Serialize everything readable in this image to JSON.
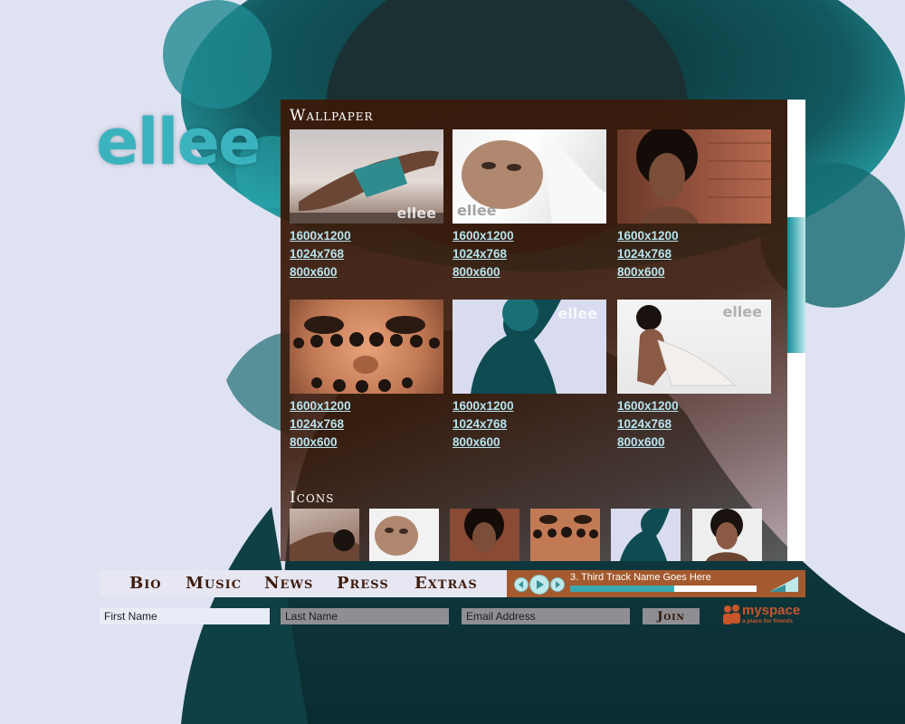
{
  "brand": {
    "logo_text": "ellee",
    "accent": "#3bb3bf",
    "panel_color": "#3a1a0a"
  },
  "wallpaper": {
    "title": "Wallpaper",
    "items": [
      {
        "name": "wallpaper-1",
        "sizes": [
          "1600x1200",
          "1024x768",
          "800x600"
        ],
        "watermark": "ellee"
      },
      {
        "name": "wallpaper-2",
        "sizes": [
          "1600x1200",
          "1024x768",
          "800x600"
        ],
        "watermark": "ellee"
      },
      {
        "name": "wallpaper-3",
        "sizes": [
          "1600x1200",
          "1024x768",
          "800x600"
        ],
        "watermark": ""
      },
      {
        "name": "wallpaper-4",
        "sizes": [
          "1600x1200",
          "1024x768",
          "800x600"
        ],
        "watermark": ""
      },
      {
        "name": "wallpaper-5",
        "sizes": [
          "1600x1200",
          "1024x768",
          "800x600"
        ],
        "watermark": "ellee"
      },
      {
        "name": "wallpaper-6",
        "sizes": [
          "1600x1200",
          "1024x768",
          "800x600"
        ],
        "watermark": "ellee"
      }
    ]
  },
  "icons": {
    "title": "Icons",
    "count": 6
  },
  "nav": {
    "items": [
      "Bio",
      "Music",
      "News",
      "Press",
      "Extras"
    ]
  },
  "player": {
    "track": "3. Third Track Name Goes Here",
    "progress": 0.56,
    "buttons": [
      "previous-icon",
      "play-icon",
      "next-icon",
      "volume-icon"
    ]
  },
  "signup": {
    "first_name_placeholder": "First Name",
    "last_name_placeholder": "Last Name",
    "email_placeholder": "Email Address",
    "join_label": "Join"
  },
  "partner": {
    "logo": "myspace",
    "tagline": "a place for friends"
  }
}
